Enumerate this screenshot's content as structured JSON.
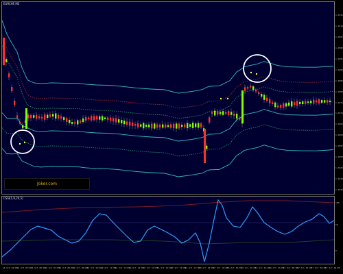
{
  "main_title": "EURCHF,M5",
  "osc_title": "CSSI(1,9,20,5)",
  "watermark": "Joker.com",
  "colors": {
    "background": "#000030",
    "bull": "#7fff00",
    "bear": "#ff3030",
    "channel_outer": "#30c0c8",
    "channel_mid": "#a02828",
    "channel_dotted": "#1e9060",
    "osc_line": "#2aa0ff",
    "osc_upper": "#7a1a2a",
    "osc_lower": "#204020",
    "osc_zero": "#3a3a80",
    "marker": "#ffff40",
    "circle": "#ffffff"
  },
  "price_scale": [
    "1.0315",
    "1.0310",
    "1.0305",
    "1.0300",
    "1.0295",
    "1.0290",
    "1.0285",
    "1.0280",
    "1.0275",
    "1.0270",
    "1.0265",
    "1.0260",
    "1.0255",
    "1.0250",
    "1.0245",
    "1.0240",
    "1.0235"
  ],
  "osc_scale": [
    "100",
    "50",
    "0"
  ],
  "time_labels": [
    "16 Oct 04:00",
    "16 Oct 05:00",
    "16 Oct 06:00",
    "16 Oct 07:00",
    "16 Oct 08:00",
    "16 Oct 09:00",
    "16 Oct 10:00",
    "16 Oct 11:00",
    "16 Oct 12:00",
    "16 Oct 13:00",
    "16 Oct 14:00",
    "16 Oct 15:00",
    "16 Oct 16:00",
    "16 Oct 17:00",
    "16 Oct 18:00",
    "16 Oct 19:00",
    "16 Oct 20:00",
    "16 Oct 21:00",
    "16 Oct 22:00",
    "16 Oct 23:00",
    "17 Oct 00:00",
    "17 Oct 01:00",
    "17 Oct 02:00",
    "17 Oct 03:00"
  ],
  "highlight_circles": [
    "buy-signal-circle",
    "sell-signal-circle"
  ]
}
